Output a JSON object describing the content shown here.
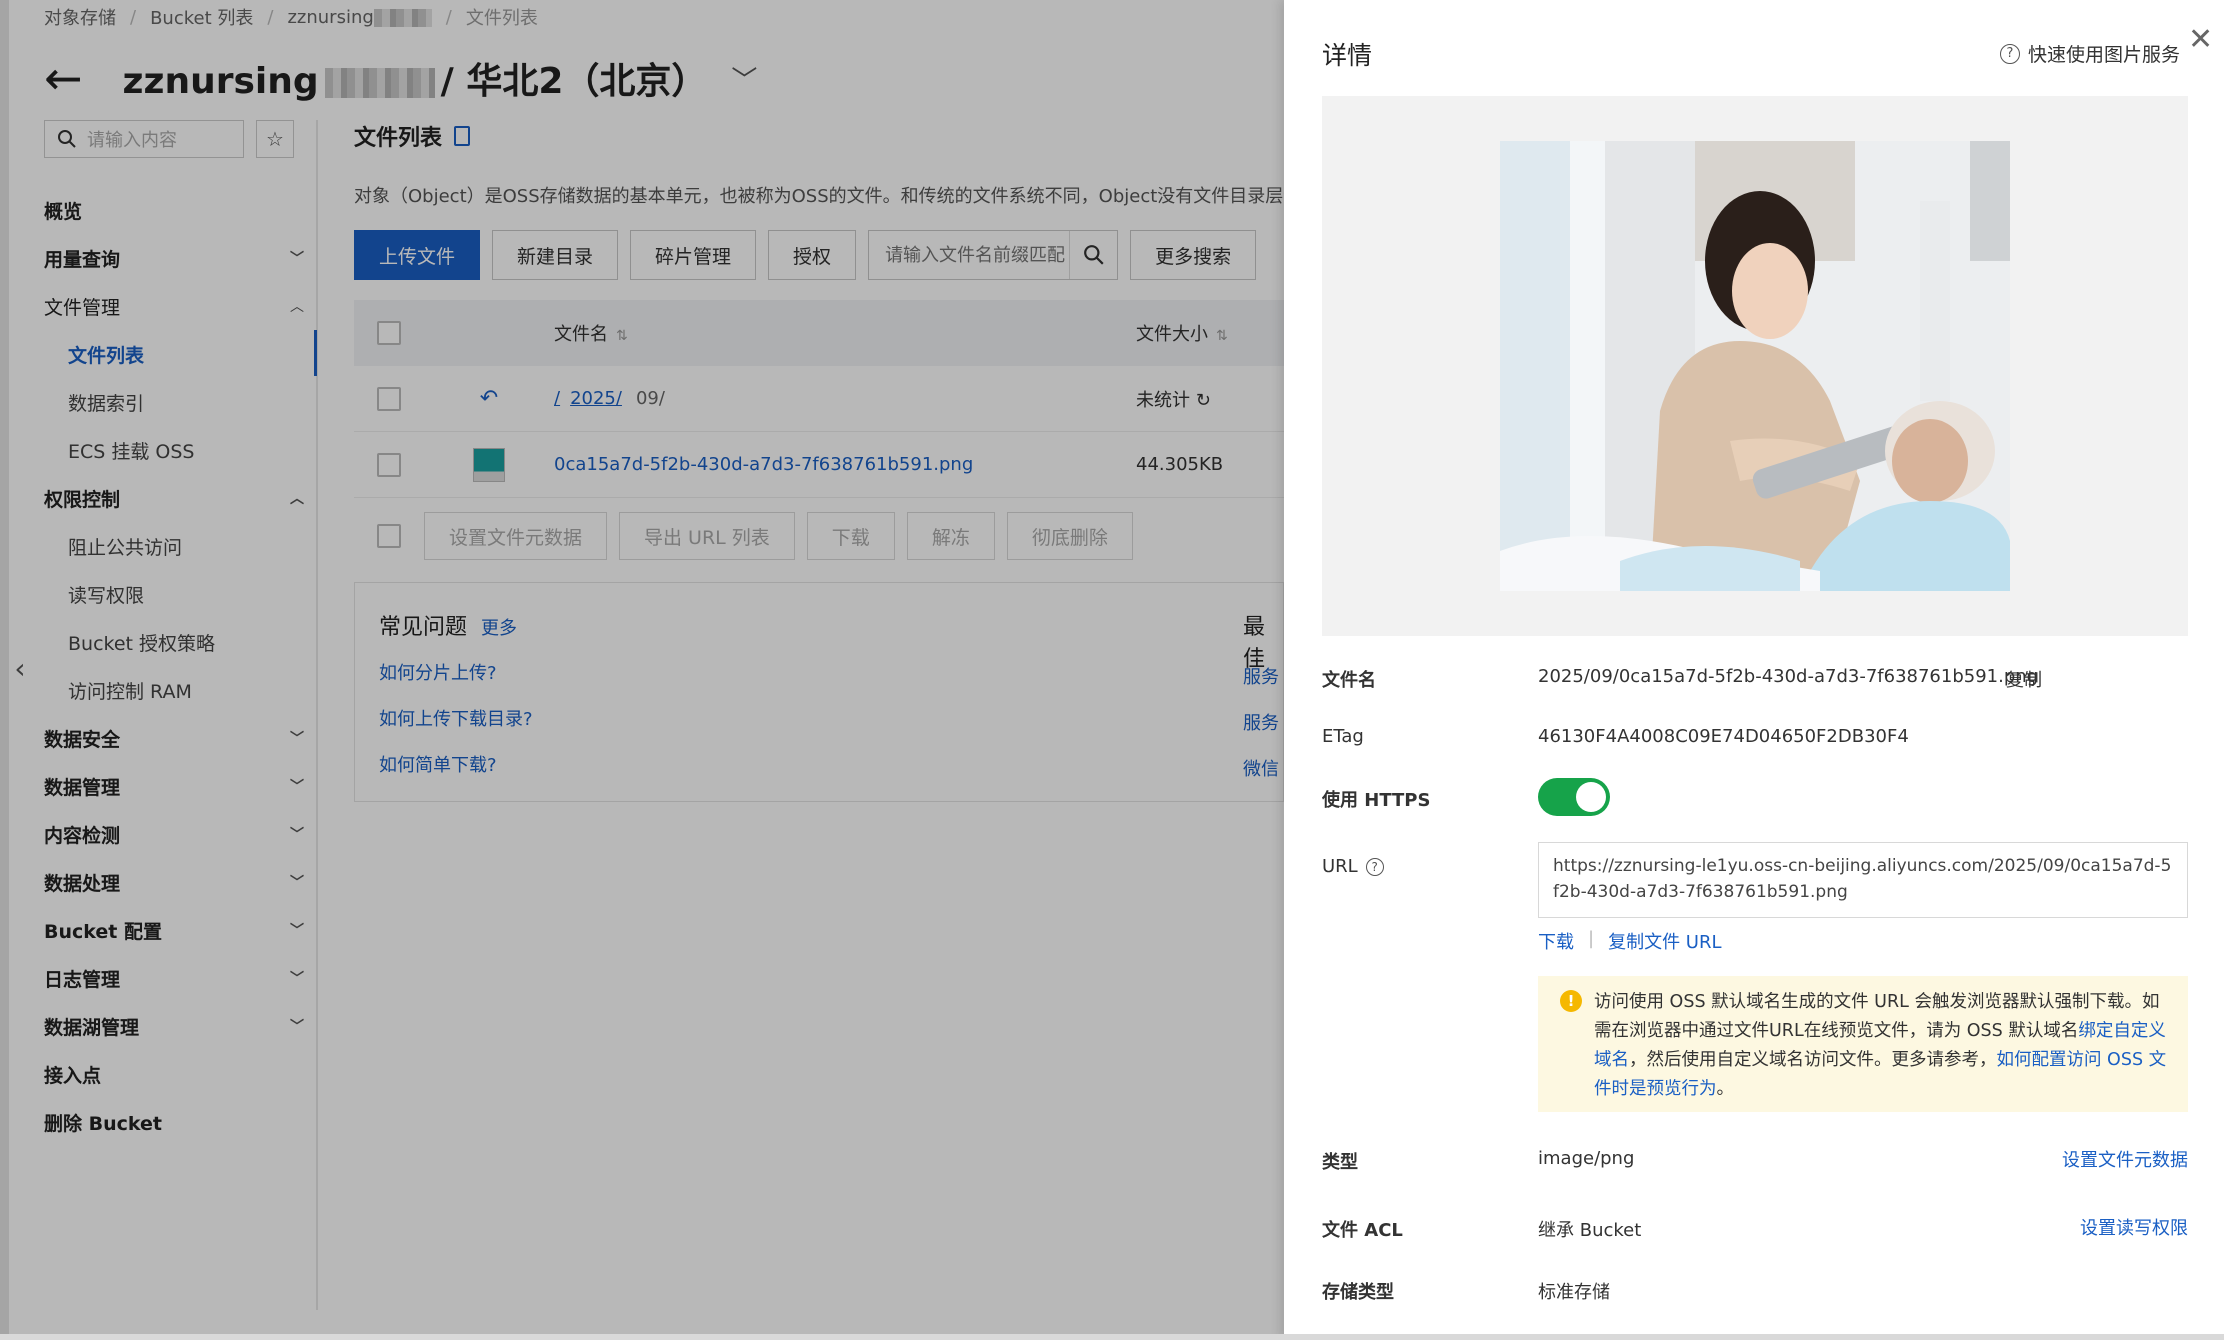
{
  "breadcrumb": {
    "items": [
      "对象存储",
      "Bucket 列表",
      "zznursing",
      "文件列表"
    ],
    "separator": "/"
  },
  "header": {
    "bucket_prefix": "zznursing",
    "bucket_suffix": "华北2（北京）"
  },
  "sidebar": {
    "search_placeholder": "请输入内容",
    "items": [
      {
        "label": "概览"
      },
      {
        "label": "用量查询"
      },
      {
        "label": "文件管理"
      },
      {
        "label": "文件列表"
      },
      {
        "label": "数据索引"
      },
      {
        "label": "ECS 挂载 OSS"
      },
      {
        "label": "权限控制"
      },
      {
        "label": "阻止公共访问"
      },
      {
        "label": "读写权限"
      },
      {
        "label": "Bucket 授权策略"
      },
      {
        "label": "访问控制 RAM"
      },
      {
        "label": "数据安全"
      },
      {
        "label": "数据管理"
      },
      {
        "label": "内容检测"
      },
      {
        "label": "数据处理"
      },
      {
        "label": "Bucket 配置"
      },
      {
        "label": "日志管理"
      },
      {
        "label": "数据湖管理"
      },
      {
        "label": "接入点"
      },
      {
        "label": "删除 Bucket"
      }
    ]
  },
  "main": {
    "title": "文件列表",
    "description": "对象（Object）是OSS存储数据的基本单元，也被称为OSS的文件。和传统的文件系统不同，Object没有文件目录层级结",
    "toolbar": {
      "upload": "上传文件",
      "new_dir": "新建目录",
      "fragments": "碎片管理",
      "authorize": "授权",
      "search_placeholder": "请输入文件名前缀匹配",
      "more_search": "更多搜索"
    },
    "table": {
      "col_name": "文件名",
      "col_size": "文件大小",
      "rows": [
        {
          "path_root": "/",
          "path_link": "2025/",
          "path_rest": "09/",
          "size": "未统计"
        },
        {
          "name": "0ca15a7d-5f2b-430d-a7d3-7f638761b591.png",
          "size": "44.305KB"
        }
      ]
    },
    "bulk": {
      "set_meta": "设置文件元数据",
      "export_url": "导出 URL 列表",
      "download": "下载",
      "unfreeze": "解冻",
      "delete": "彻底删除"
    },
    "faq": {
      "title": "常见问题",
      "more": "更多",
      "links": [
        "如何分片上传?",
        "如何上传下载目录?",
        "如何简单下载?"
      ],
      "best_title": "最佳",
      "best_links": [
        "服务",
        "服务",
        "微信"
      ]
    }
  },
  "drawer": {
    "title": "详情",
    "help": "快速使用图片服务",
    "fields": {
      "filename_label": "文件名",
      "filename_value": "2025/09/0ca15a7d-5f2b-430d-a7d3-7f638761b591.png",
      "copy": "复制",
      "etag_label": "ETag",
      "etag_value": "46130F4A4008C09E74D04650F2DB30F4",
      "https_label": "使用 HTTPS",
      "https_enabled": true,
      "url_label": "URL",
      "url_value": "https://zznursing-le1yu.oss-cn-beijing.aliyuncs.com/2025/09/0ca15a7d-5f2b-430d-a7d3-7f638761b591.png",
      "download": "下载",
      "copy_url": "复制文件 URL",
      "notice_1": "访问使用 OSS 默认域名生成的文件 URL 会触发浏览器默认强制下载。如需在浏览器中通过文件URL在线预览文件，请为 OSS 默认域名",
      "notice_link_1": "绑定自定义域名",
      "notice_2": "，然后使用自定义域名访问文件。更多请参考，",
      "notice_link_2": "如何配置访问 OSS 文件时是预览行为",
      "notice_3": "。",
      "type_label": "类型",
      "type_value": "image/png",
      "set_meta": "设置文件元数据",
      "acl_label": "文件 ACL",
      "acl_value": "继承 Bucket",
      "set_acl": "设置读写权限",
      "storage_label": "存储类型",
      "storage_value": "标准存储"
    }
  },
  "colors": {
    "primary": "#1a5fc4",
    "toggle_on": "#16a34a",
    "notice_bg": "#fdf8e1"
  }
}
